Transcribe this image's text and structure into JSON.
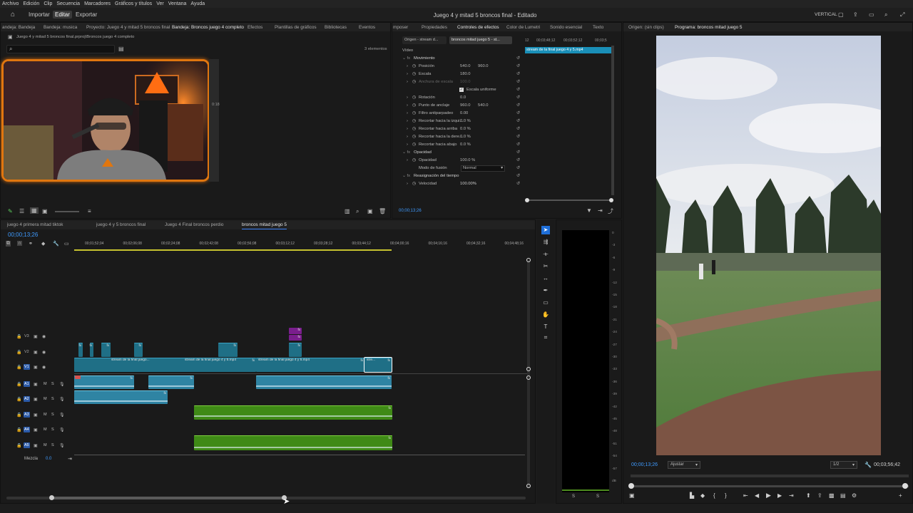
{
  "menu": [
    "Archivo",
    "Edición",
    "Clip",
    "Secuencia",
    "Marcadores",
    "Gráficos y títulos",
    "Ver",
    "Ventana",
    "Ayuda"
  ],
  "header": {
    "home_tab": "Importar",
    "edit_tab": "Editar",
    "export_tab": "Exportar",
    "title": "Juego 4 y mitad 5 broncos final - Editado",
    "workspace": "VERTICAL"
  },
  "project": {
    "tabs": [
      "andeja: Bandeja",
      "Bandeja: musica",
      "Proyecto: Juego 4 y mitad 5 broncos final",
      "Bandeja: Broncos juego 4 completo",
      "Efectos",
      "Plantillas de gráficos",
      "Bibliotecas",
      "Eventos"
    ],
    "path": "Juego 4 y mitad 5 broncos final.prproj\\Broncos juego 4 completo",
    "count": "3 elementos",
    "thumb_duration": "0:18"
  },
  "effects": {
    "tabs": [
      "mposer",
      "Propiedades",
      "Controles de efectos",
      "Color de Lumetri",
      "Sonido esencial",
      "Texto"
    ],
    "source_tab": "Origen - stream d...",
    "clip_tab": "broncos mitad juego 5 - st...",
    "ruler": [
      "12",
      "00;03;48;12",
      "00;03;52;12",
      "00;03;5"
    ],
    "clip_label": "stream de la final juego 4 y 5.mp4",
    "section_video": "Vídeo",
    "rows": [
      {
        "name": "Movimiento",
        "v1": "",
        "v2": ""
      },
      {
        "name": "Posición",
        "v1": "540.0",
        "v2": "960.0"
      },
      {
        "name": "Escala",
        "v1": "180.0",
        "v2": ""
      },
      {
        "name": "Anchura de escala",
        "v1": "100.0",
        "v2": ""
      },
      {
        "name": "Escala uniforme",
        "v1": "",
        "v2": ""
      },
      {
        "name": "Rotación",
        "v1": "0.0",
        "v2": ""
      },
      {
        "name": "Punto de anclaje",
        "v1": "960.0",
        "v2": "540.0"
      },
      {
        "name": "Filtro antiparpadeo",
        "v1": "0.00",
        "v2": ""
      },
      {
        "name": "Recortar hacia la izqui...",
        "v1": "0.0 %",
        "v2": ""
      },
      {
        "name": "Recortar hacia arriba",
        "v1": "0.0 %",
        "v2": ""
      },
      {
        "name": "Recortar hacia la dere...",
        "v1": "0.0 %",
        "v2": ""
      },
      {
        "name": "Recortar hacia abajo",
        "v1": "0.0 %",
        "v2": ""
      },
      {
        "name": "Opacidad",
        "v1": "",
        "v2": ""
      },
      {
        "name": "Opacidad",
        "v1": "100.0 %",
        "v2": ""
      },
      {
        "name": "Modo de fusión",
        "v1": "Normal",
        "v2": ""
      },
      {
        "name": "Reasignación del tiempo",
        "v1": "",
        "v2": ""
      },
      {
        "name": "Velocidad",
        "v1": "100.00%",
        "v2": ""
      }
    ],
    "timecode": "00;00;13;26"
  },
  "program": {
    "source_tab": "Origen: (sin clips)",
    "program_tab": "Programa: broncos mitad juego 5",
    "timecode": "00;00;13;26",
    "fit": "Ajustar",
    "resolution": "1/2",
    "duration": "00;03;56;42"
  },
  "timeline": {
    "tabs": [
      "juego 4 primera mitad tiktok",
      "juego 4 y 5 broncos final",
      "Juego 4 Final broncos perdio",
      "broncos mitad juego 5"
    ],
    "timecode": "00;00;13;26",
    "ruler": [
      "00;01;52;04",
      "00;02;06;08",
      "00;02;24;08",
      "00;02;42;08",
      "00;02;56;08",
      "00;03;12;12",
      "00;03;28;12",
      "00;03;44;12",
      "00;04;00;16",
      "00;04;16;16",
      "00;04;32;16",
      "00;04;48;16"
    ],
    "tracks": [
      "V3",
      "V2",
      "V1",
      "A1",
      "A2",
      "A3",
      "A4",
      "A5"
    ],
    "mix_label": "Mezcla",
    "mix_value": "0.0",
    "clip_labels": [
      "stream de la final juego...",
      "stream de la final juego 4 y 5.mp4",
      "stream de la final juego 4 y 5.mp4",
      "stre..."
    ]
  },
  "meter_scale": [
    "0",
    "-3",
    "-6",
    "-9",
    "-12",
    "-15",
    "-18",
    "-21",
    "-24",
    "-27",
    "-30",
    "-33",
    "-36",
    "-39",
    "-42",
    "-45",
    "-48",
    "-51",
    "-54",
    "-57",
    "dB"
  ],
  "meter_channels": [
    "S",
    "S"
  ]
}
